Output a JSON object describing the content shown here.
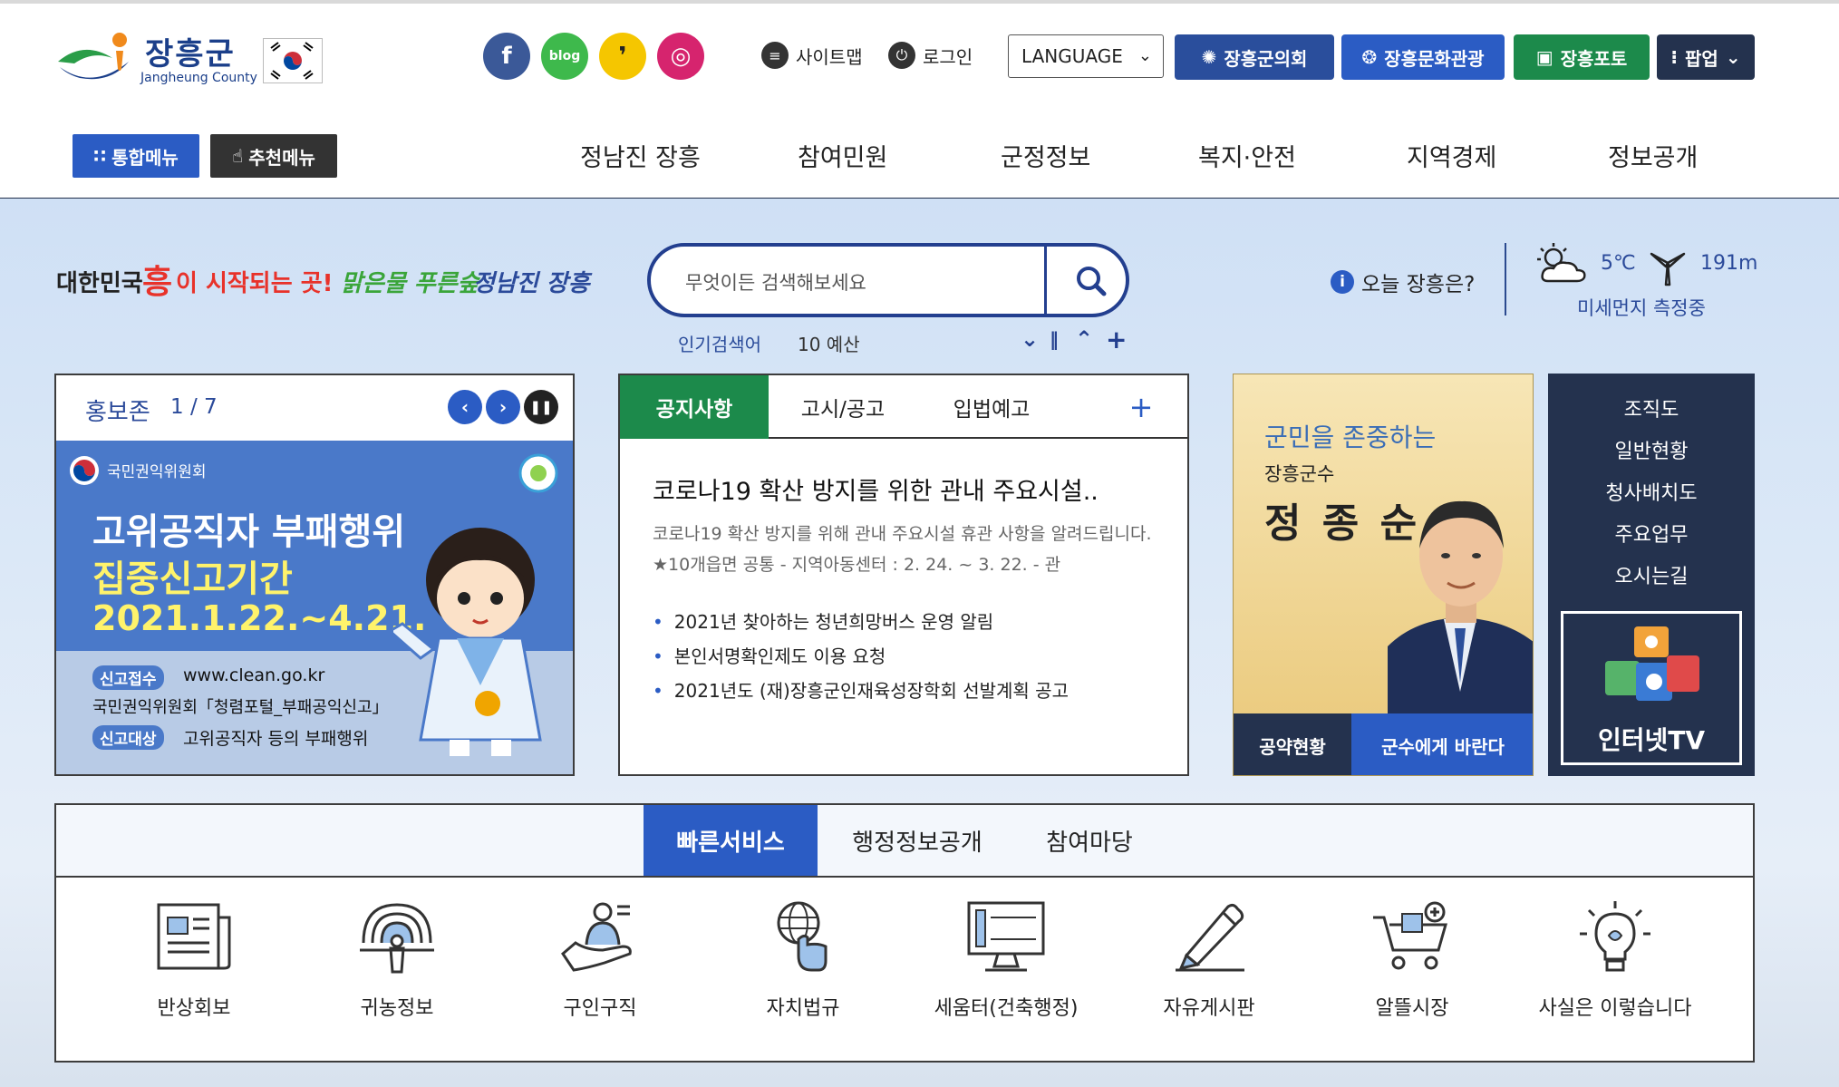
{
  "header": {
    "logo_title": "장흥군",
    "logo_sub": "Jangheung County",
    "sns": [
      {
        "name": "facebook-icon",
        "glyph": "f",
        "color": "#3b5998"
      },
      {
        "name": "blog-icon",
        "glyph": "blog",
        "color": "#3eb94c"
      },
      {
        "name": "kakao-story-icon",
        "glyph": "❜",
        "color": "#f5c600"
      },
      {
        "name": "instagram-icon",
        "glyph": "◎",
        "color": "#d6246e"
      }
    ],
    "sitemap_label": "사이트맵",
    "login_label": "로그인",
    "language_label": "LANGUAGE",
    "buttons": {
      "council": "장흥군의회",
      "culture": "장흥문화관광",
      "photo": "장흥포토",
      "popup": "팝업"
    },
    "button_colors": {
      "council": "#2a4e9c",
      "culture": "#2b5cc4",
      "photo": "#1c8a4b",
      "popup": "#24324e"
    }
  },
  "nav": {
    "all_menu": "통합메뉴",
    "recommend_menu": "추천메뉴",
    "items": [
      "정남진 장흥",
      "참여민원",
      "군정정보",
      "복지·안전",
      "지역경제",
      "정보공개"
    ]
  },
  "hero": {
    "slogan_part1": "대한민국",
    "slogan_hong": "흥",
    "slogan_part2": "이 시작되는 곳!",
    "slogan_green": "맑은물 푸른숲",
    "slogan_blue": "정남진 장흥",
    "search_placeholder": "무엇이든 검색해보세요",
    "popular_label": "인기검색어",
    "popular_term": "10 예산",
    "today_label": "오늘 장흥은?",
    "temperature": "5℃",
    "wind": "191m",
    "dust": "미세먼지 측정중"
  },
  "promo": {
    "title": "홍보존",
    "counter": "1 / 7",
    "banner_org": "국민권익위원회",
    "banner_line1": "고위공직자 부패행위",
    "banner_line2": "집중신고기간",
    "banner_dates": "2021.1.22.~4.21.",
    "tag1": "신고접수",
    "url": "www.clean.go.kr",
    "portal": "국민권익위원회「청렴포털_부패공익신고」",
    "tag2": "신고대상",
    "target": "고위공직자 등의 부패행위"
  },
  "notice": {
    "tabs": [
      "공지사항",
      "고시/공고",
      "입법예고"
    ],
    "more": "+",
    "headline": "코로나19 확산 방지를 위한 관내 주요시설..",
    "summary": "코로나19 확산 방지를 위해 관내 주요시설 휴관 사항을 알려드립니다. ★10개읍면 공통 - 지역아동센터 : 2. 24. ~ 3. 22. - 관",
    "items": [
      "2021년 찾아하는 청년희망버스 운영 알림",
      "본인서명확인제도 이용 요청",
      "2021년도 (재)장흥군인재육성장학회 선발계획 공고"
    ]
  },
  "governor": {
    "slogan": "군민을 존중하는",
    "title": "장흥군수",
    "name": "정 종 순",
    "btn_pledge": "공약현황",
    "btn_wish": "군수에게 바란다"
  },
  "side_menu": {
    "items": [
      "조직도",
      "일반현황",
      "청사배치도",
      "주요업무",
      "오시는길"
    ],
    "tv_label": "인터넷TV"
  },
  "quick": {
    "tabs": [
      "빠른서비스",
      "행정정보공개",
      "참여마당"
    ],
    "services": [
      {
        "label": "반상회보",
        "icon": "newspaper-icon"
      },
      {
        "label": "귀농정보",
        "icon": "farmer-icon"
      },
      {
        "label": "구인구직",
        "icon": "job-hand-icon"
      },
      {
        "label": "자치법규",
        "icon": "globe-hand-icon"
      },
      {
        "label": "세움터(건축행정)",
        "icon": "monitor-icon"
      },
      {
        "label": "자유게시판",
        "icon": "pencil-icon"
      },
      {
        "label": "알뜰시장",
        "icon": "cart-icon"
      },
      {
        "label": "사실은 이렇습니다",
        "icon": "lightbulb-icon"
      }
    ]
  }
}
